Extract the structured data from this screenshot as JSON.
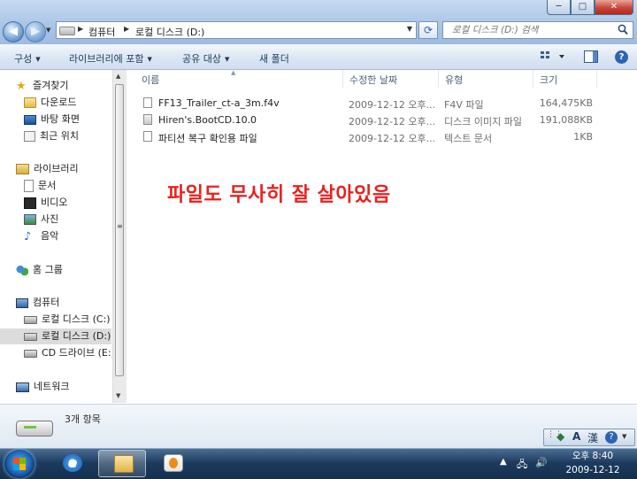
{
  "window": {
    "address": {
      "segments": [
        "컴퓨터",
        "로컬 디스크 (D:)"
      ]
    },
    "search": {
      "placeholder": "로컬 디스크 (D:) 검색"
    },
    "controls": {
      "minimize": "─",
      "maximize": "□",
      "close": "✕"
    }
  },
  "toolbar": {
    "organize": "구성",
    "include_library": "라이브러리에 포함",
    "share_with": "공유 대상",
    "new_folder": "새 폴더"
  },
  "sidebar": {
    "favorites": {
      "label": "즐겨찾기",
      "items": [
        "다운로드",
        "바탕 화면",
        "최근 위치"
      ]
    },
    "libraries": {
      "label": "라이브러리",
      "items": [
        "문서",
        "비디오",
        "사진",
        "음악"
      ]
    },
    "homegroup": {
      "label": "홈 그룹"
    },
    "computer": {
      "label": "컴퓨터",
      "items": [
        "로컬 디스크 (C:)",
        "로컬 디스크 (D:)",
        "CD 드라이브 (E:)"
      ],
      "selected": "로컬 디스크 (D:)"
    },
    "network": {
      "label": "네트워크"
    }
  },
  "file_list": {
    "columns": [
      "이름",
      "수정한 날짜",
      "유형",
      "크기"
    ],
    "rows": [
      {
        "name": "FF13_Trailer_ct-a_3m.f4v",
        "date": "2009-12-12 오후...",
        "type": "F4V 파일",
        "size": "164,475KB"
      },
      {
        "name": "Hiren's.BootCD.10.0",
        "date": "2009-12-12 오후...",
        "type": "디스크 이미지 파일",
        "size": "191,088KB"
      },
      {
        "name": "파티션 복구 확인용 파일",
        "date": "2009-12-12 오후...",
        "type": "텍스트 문서",
        "size": "1KB"
      }
    ]
  },
  "annotation": {
    "text": "파일도 무사히 잘 살아있음",
    "color": "#e8211e"
  },
  "details": {
    "item_count": "3개 항목"
  },
  "taskbar": {
    "apps": [
      "internet-explorer",
      "windows-explorer",
      "media-center"
    ],
    "active_app": "windows-explorer",
    "language_bar": {
      "ime_mode": "A",
      "hanja": "漢",
      "help": "?"
    },
    "clock": {
      "time": "오후 8:40",
      "date": "2009-12-12"
    }
  }
}
